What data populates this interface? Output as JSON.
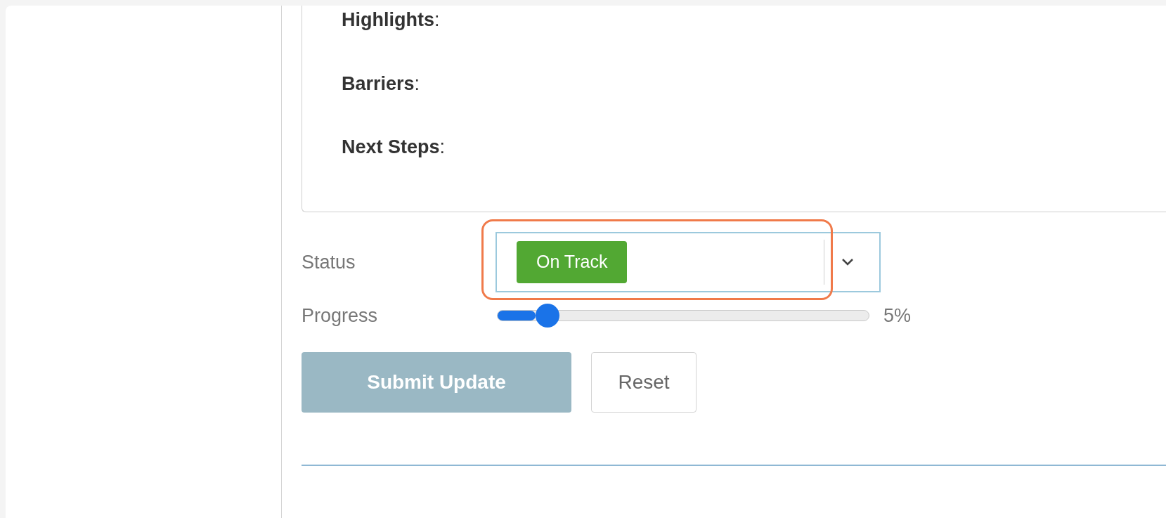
{
  "notes_field": {
    "lines": [
      "**Highlights**:",
      "**Barriers**:",
      "**Next Steps**:"
    ]
  },
  "status": {
    "label": "Status",
    "value": "On Track",
    "color": "#52a833",
    "highlighted": true
  },
  "progress": {
    "label": "Progress",
    "level": 0.05,
    "reading": "5%"
  },
  "buttons": [
    {
      "kind": "primary",
      "label": "Submit Update",
      "disabled": true
    },
    {
      "kind": "secondary",
      "label": "Reset",
      "disabled": false
    }
  ]
}
